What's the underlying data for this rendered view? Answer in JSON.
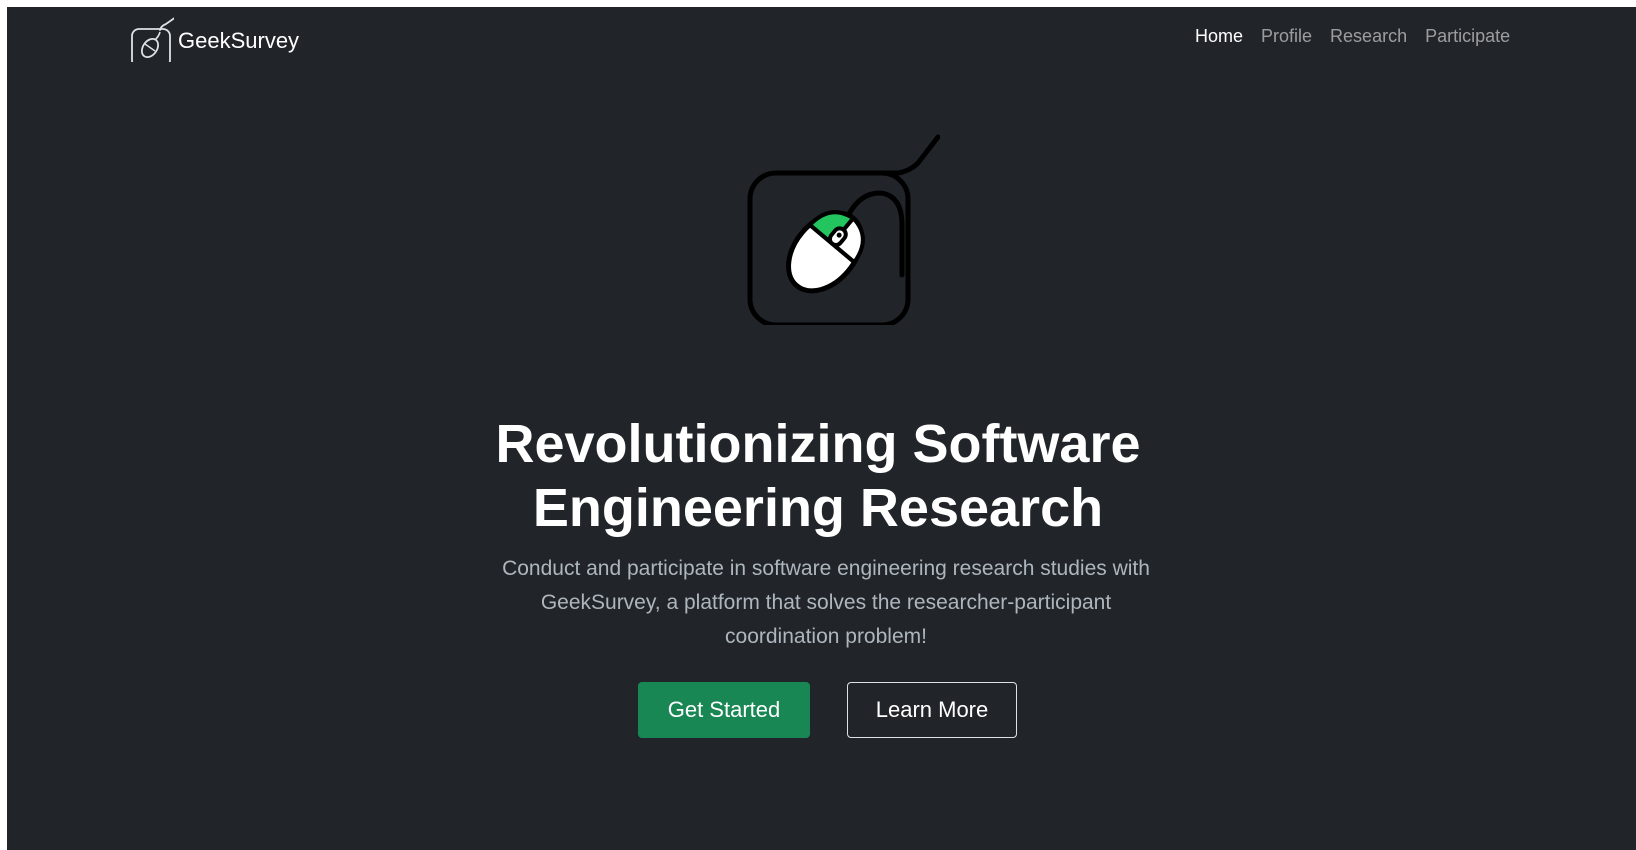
{
  "brand": {
    "name": "GeekSurvey",
    "logo_icon": "mouse-pad-icon"
  },
  "nav": {
    "items": [
      {
        "label": "Home",
        "active": true
      },
      {
        "label": "Profile",
        "active": false
      },
      {
        "label": "Research",
        "active": false
      },
      {
        "label": "Participate",
        "active": false
      }
    ]
  },
  "hero": {
    "logo_icon": "mouse-pad-icon",
    "title_line1": "Revolutionizing Software",
    "title_line2": "Engineering Research",
    "lead": "Conduct and participate in software engineering research studies with GeekSurvey, a platform that solves the researcher-participant coordination problem!",
    "primary_button": "Get Started",
    "secondary_button": "Learn More"
  },
  "colors": {
    "background": "#212529",
    "accent": "#198754",
    "mouse_highlight": "#22c55e",
    "muted_text": "#adb5bd"
  }
}
